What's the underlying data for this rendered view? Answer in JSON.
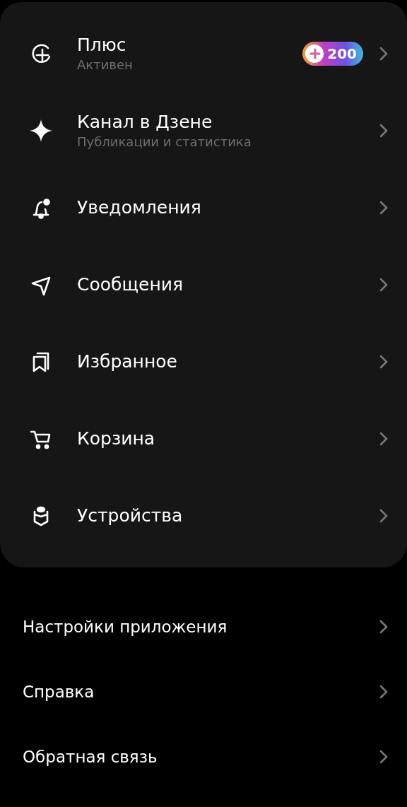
{
  "menu": [
    {
      "title": "Плюс",
      "subtitle": "Активен",
      "badge": "200"
    },
    {
      "title": "Канал в Дзене",
      "subtitle": "Публикации и статистика"
    },
    {
      "title": "Уведомления"
    },
    {
      "title": "Сообщения"
    },
    {
      "title": "Избранное"
    },
    {
      "title": "Корзина"
    },
    {
      "title": "Устройства"
    }
  ],
  "links": [
    {
      "title": "Настройки приложения"
    },
    {
      "title": "Справка"
    },
    {
      "title": "Обратная связь"
    }
  ]
}
